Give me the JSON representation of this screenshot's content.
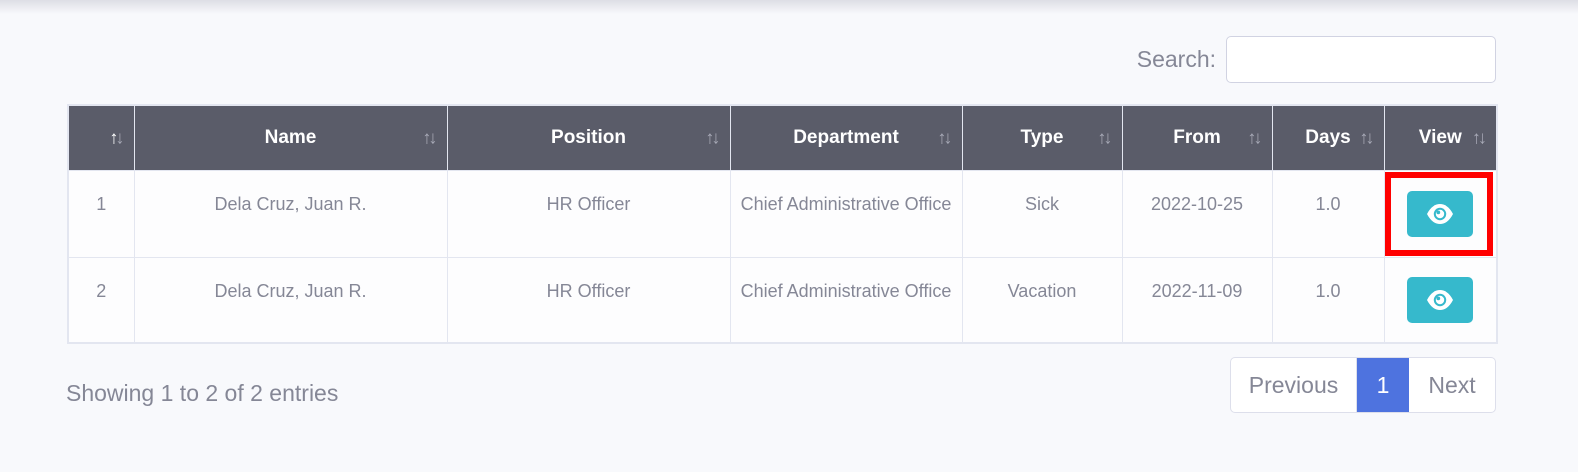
{
  "search": {
    "label": "Search:",
    "value": "",
    "placeholder": ""
  },
  "table": {
    "columns": [
      "",
      "Name",
      "Position",
      "Department",
      "Type",
      "From",
      "Days",
      "View"
    ],
    "sort_icon": "↑↓",
    "rows": [
      {
        "no": "1",
        "name": "Dela Cruz, Juan R.",
        "position": "HR Officer",
        "department": "Chief Administrative Office",
        "type": "Sick",
        "from": "2022-10-25",
        "days": "1.0",
        "view_icon": "eye-icon"
      },
      {
        "no": "2",
        "name": "Dela Cruz, Juan R.",
        "position": "HR Officer",
        "department": "Chief Administrative Office",
        "type": "Vacation",
        "from": "2022-11-09",
        "days": "1.0",
        "view_icon": "eye-icon"
      }
    ]
  },
  "footer": {
    "info": "Showing 1 to 2 of 2 entries"
  },
  "pagination": {
    "previous": "Previous",
    "current": "1",
    "next": "Next"
  },
  "colors": {
    "header_bg": "#5a5c69",
    "view_button": "#36b9cc",
    "active_page": "#4e73df",
    "highlight": "#ff0000"
  }
}
